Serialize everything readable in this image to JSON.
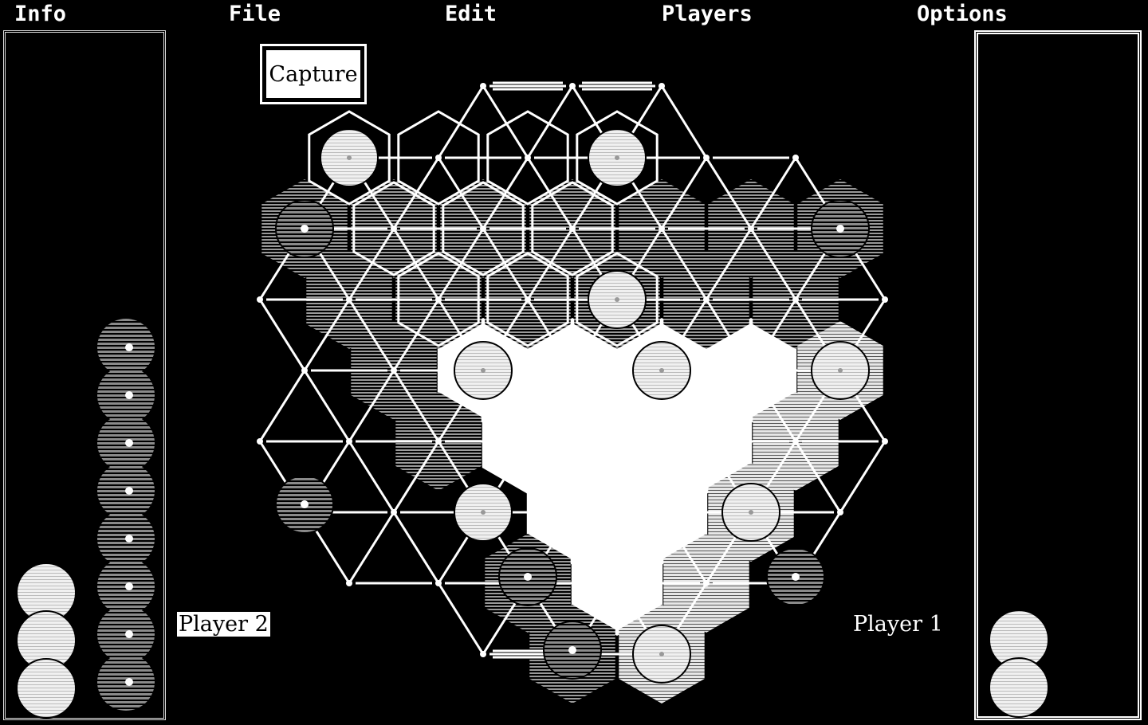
{
  "menu": [
    "Info",
    "File",
    "Edit",
    "Players",
    "Options"
  ],
  "capture_button": "Capture",
  "players": {
    "left": "Player 2",
    "right": "Player 1"
  },
  "colors": {
    "background": "#000000",
    "line": "#ffffff",
    "light_stone": "#d9d9d9",
    "dark_stone": "#5a5a5a",
    "territory_light": "#ffffff",
    "territory_gray": "#8a8a8a"
  },
  "trays": {
    "left_light_stones": 3,
    "left_dark_stones": 8,
    "right_light_stones": 2
  }
}
